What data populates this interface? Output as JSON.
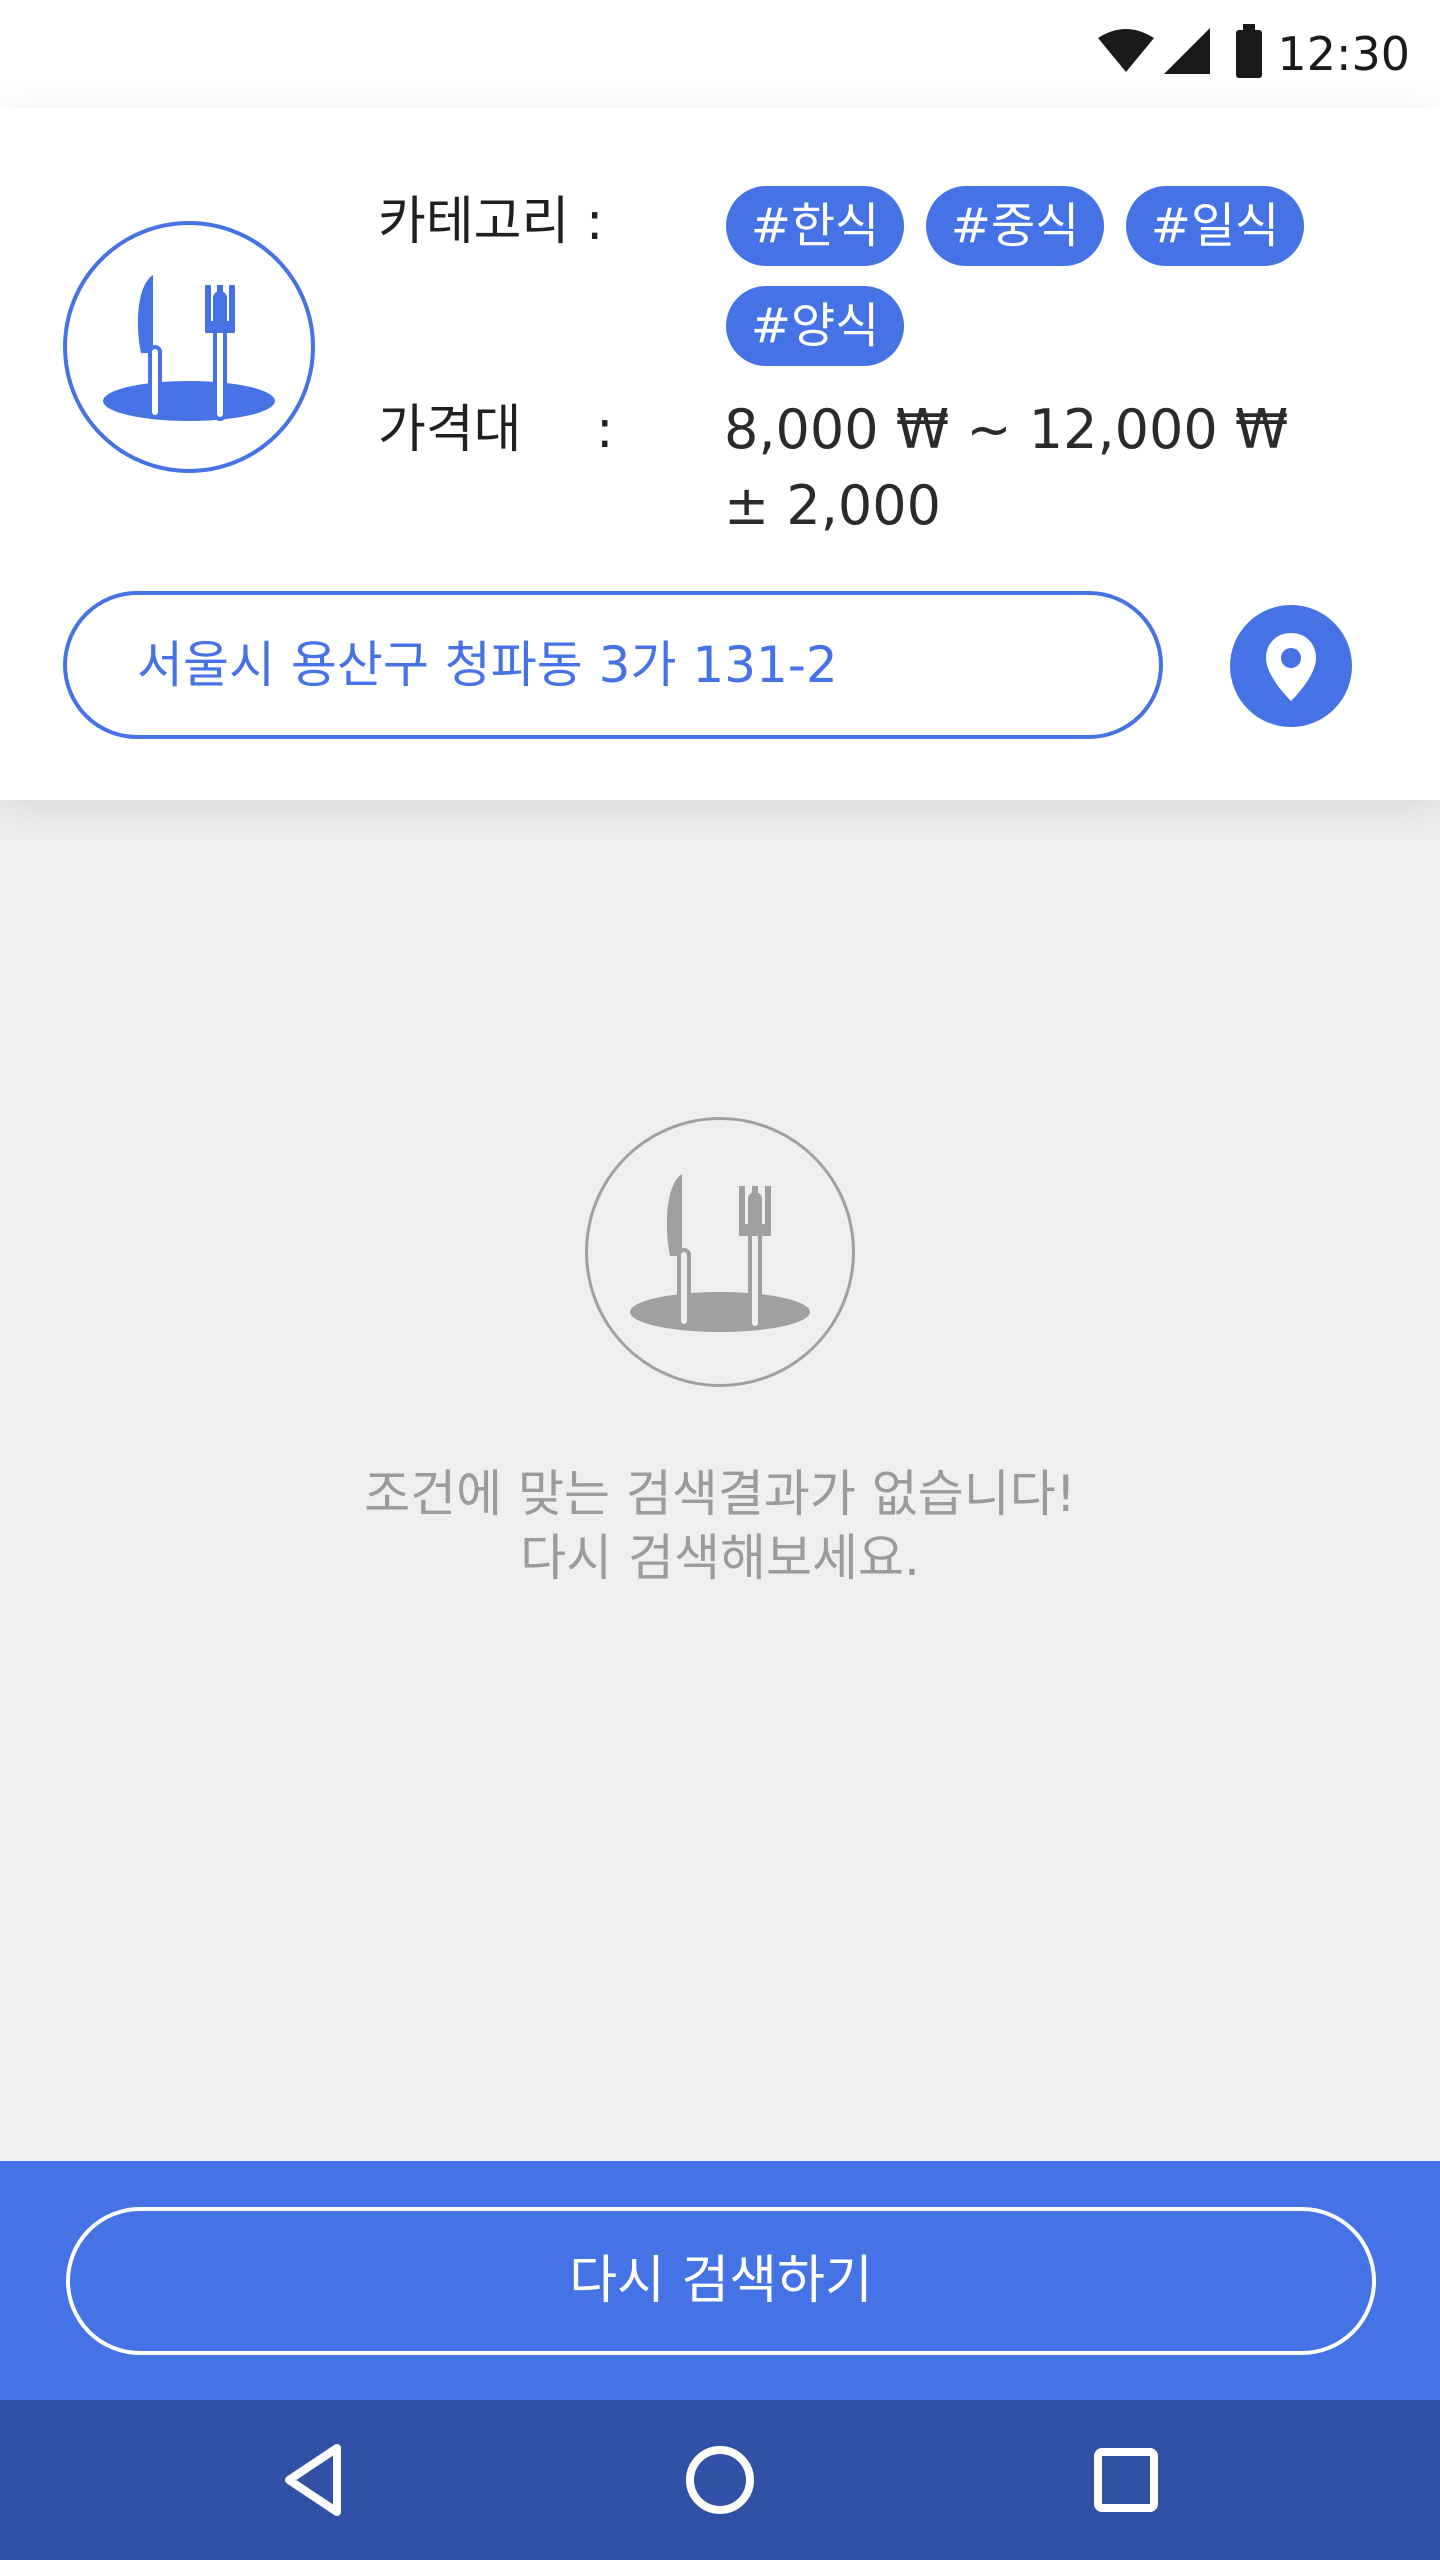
{
  "status_bar": {
    "time": "12:30",
    "icons": [
      "wifi-icon",
      "signal-icon",
      "battery-icon"
    ]
  },
  "header": {
    "category_label": "카테고리 :",
    "category_tags": [
      "#한식",
      "#중식",
      "#일식",
      "#양식"
    ],
    "price_label": "가격대",
    "price_colon": ":",
    "price_range": "8,000 ₩ ~ 12,000 ₩",
    "price_tolerance": "± 2,000",
    "address": "서울시 용산구 청파동 3가 131-2",
    "location_icon": "location-pin-icon"
  },
  "empty_state": {
    "icon": "knife-fork-icon",
    "line1": "조건에 맞는 검색결과가 없습니다!",
    "line2": "다시 검색해보세요."
  },
  "actions": {
    "search_again_label": "다시 검색하기"
  },
  "nav_bar": {
    "buttons": [
      "back-icon",
      "home-icon",
      "recents-icon"
    ]
  },
  "colors": {
    "accent": "#4573e6",
    "nav": "#3051a6",
    "background": "#efefef",
    "muted": "#9b9b9b"
  }
}
